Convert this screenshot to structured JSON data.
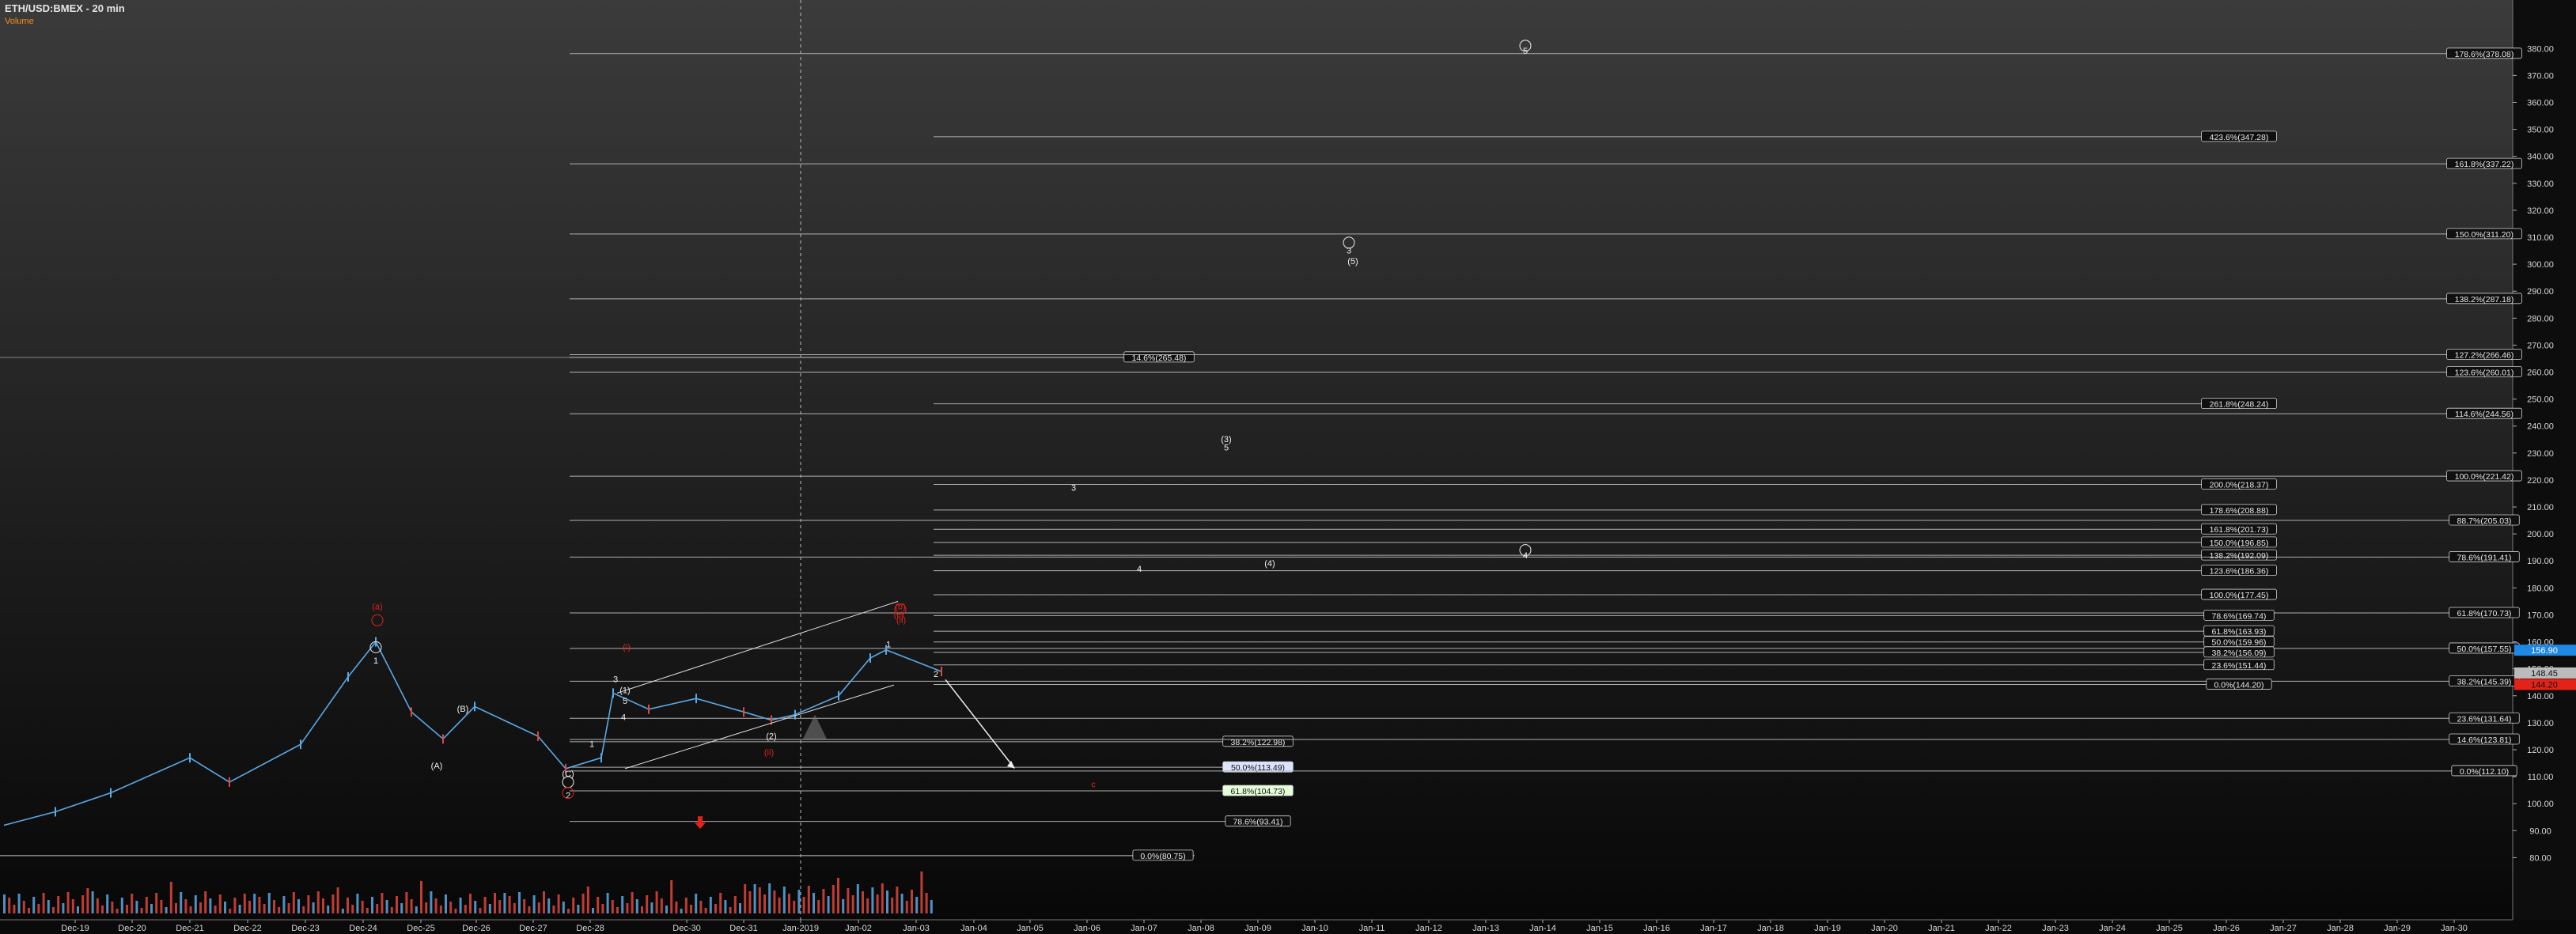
{
  "header": {
    "title": "ETH/USD:BMEX - 20 min",
    "subtitle": "Volume"
  },
  "chart_data": {
    "type": "line",
    "title": "ETH/USD:BMEX - 20 min",
    "ylim": [
      70,
      390
    ],
    "y_ticks": [
      80,
      90,
      100,
      110,
      120,
      130,
      140,
      150,
      160,
      170,
      180,
      190,
      200,
      210,
      220,
      230,
      240,
      250,
      260,
      270,
      280,
      290,
      300,
      310,
      320,
      330,
      340,
      350,
      360,
      370,
      380
    ],
    "y_tick_labels": [
      "80.00",
      "90.00",
      "100.00",
      "110.00",
      "120.00",
      "130.00",
      "140.00",
      "150.00",
      "160.00",
      "170.00",
      "180.00",
      "190.00",
      "200.00",
      "210.00",
      "220.00",
      "230.00",
      "240.00",
      "250.00",
      "260.00",
      "270.00",
      "280.00",
      "290.00",
      "300.00",
      "310.00",
      "320.00",
      "330.00",
      "340.00",
      "350.00",
      "360.00",
      "370.00",
      "380.00"
    ],
    "x_categories": [
      "Dec-19",
      "Dec-20",
      "Dec-21",
      "Dec-22",
      "Dec-23",
      "Dec-24",
      "Dec-25",
      "Dec-26",
      "Dec-27",
      "Dec-28",
      "Dec-30",
      "Dec-31",
      "Jan-2019",
      "Jan-02",
      "Jan-03",
      "Jan-04",
      "Jan-05",
      "Jan-06",
      "Jan-07",
      "Jan-08",
      "Jan-09",
      "Jan-10",
      "Jan-11",
      "Jan-12",
      "Jan-13",
      "Jan-14",
      "Jan-15",
      "Jan-16",
      "Jan-17",
      "Jan-18",
      "Jan-19",
      "Jan-20",
      "Jan-21",
      "Jan-22",
      "Jan-23",
      "Jan-24",
      "Jan-25",
      "Jan-26",
      "Jan-27",
      "Jan-28",
      "Jan-29",
      "Jan-30"
    ],
    "price_series": {
      "name": "ETH/USD:BMEX",
      "x": [
        "Dec-18",
        "Dec-19",
        "Dec-20",
        "Dec-21",
        "Dec-22",
        "Dec-23",
        "Dec-24",
        "Dec-24",
        "Dec-25",
        "Dec-25",
        "Dec-26",
        "Dec-27",
        "Dec-28",
        "Dec-28",
        "Dec-28",
        "Dec-29",
        "Dec-30",
        "Dec-31",
        "Dec-31",
        "Jan-2019",
        "Jan-01",
        "Jan-02",
        "Jan-02",
        "Jan-03"
      ],
      "values": [
        92,
        97,
        104,
        117,
        108,
        122,
        147,
        160,
        134,
        124,
        136,
        125,
        113,
        117,
        141,
        135,
        139,
        134,
        131,
        133,
        140,
        154,
        157,
        149
      ]
    },
    "volume_series": {
      "name": "Volume",
      "type": "bar"
    },
    "last_price": "156.90",
    "price_tags": [
      "148.45",
      "144.20"
    ],
    "fib_levels": [
      {
        "label": "178.6%(378.08)",
        "value": 378.08
      },
      {
        "label": "423.6%(347.28)",
        "value": 347.28
      },
      {
        "label": "161.8%(337.22)",
        "value": 337.22
      },
      {
        "label": "150.0%(311.20)",
        "value": 311.2
      },
      {
        "label": "138.2%(287.18)",
        "value": 287.18
      },
      {
        "label": "14.6%(265.48)",
        "value": 265.48
      },
      {
        "label": "127.2%(266.46)",
        "value": 266.46
      },
      {
        "label": "123.6%(260.01)",
        "value": 260.01
      },
      {
        "label": "261.8%(248.24)",
        "value": 248.24
      },
      {
        "label": "114.6%(244.56)",
        "value": 244.56
      },
      {
        "label": "100.0%(221.42)",
        "value": 221.42
      },
      {
        "label": "200.0%(218.37)",
        "value": 218.37
      },
      {
        "label": "178.6%(208.88)",
        "value": 208.88
      },
      {
        "label": "88.7%(205.03)",
        "value": 205.03
      },
      {
        "label": "161.8%(201.73)",
        "value": 201.73
      },
      {
        "label": "150.0%(196.85)",
        "value": 196.85
      },
      {
        "label": "138.2%(192.09)",
        "value": 192.09
      },
      {
        "label": "78.6%(191.41)",
        "value": 191.41
      },
      {
        "label": "123.6%(186.36)",
        "value": 186.36
      },
      {
        "label": "100.0%(177.45)",
        "value": 177.45
      },
      {
        "label": "61.8%(170.73)",
        "value": 170.73
      },
      {
        "label": "78.6%(169.74)",
        "value": 169.74
      },
      {
        "label": "61.8%(163.93)",
        "value": 163.93
      },
      {
        "label": "50.0%(159.96)",
        "value": 159.96
      },
      {
        "label": "50.0%(157.55)",
        "value": 157.55
      },
      {
        "label": "38.2%(156.09)",
        "value": 156.09
      },
      {
        "label": "23.6%(151.44)",
        "value": 151.44
      },
      {
        "label": "38.2%(145.39)",
        "value": 145.39
      },
      {
        "label": "0.0%(144.20)",
        "value": 144.2
      },
      {
        "label": "23.6%(131.64)",
        "value": 131.64
      },
      {
        "label": "38.2%(122.98)",
        "value": 122.98
      },
      {
        "label": "14.6%(123.81)",
        "value": 123.81
      },
      {
        "label": "50.0%(113.49)",
        "value": 113.49
      },
      {
        "label": "0.0%(112.10)",
        "value": 112.1
      },
      {
        "label": "61.8%(104.73)",
        "value": 104.73
      },
      {
        "label": "78.6%(93.41)",
        "value": 93.41
      },
      {
        "label": "0.0%(80.75)",
        "value": 80.75
      }
    ],
    "wave_labels": [
      "1",
      "(B)",
      "(A)",
      "(C)",
      "2",
      "(1)",
      "5",
      "3",
      "4",
      "1",
      "(2)",
      "1",
      "2",
      "3",
      "4",
      "(4)",
      "(3)",
      "5",
      "3",
      "(5)",
      "4",
      "5",
      "(a)",
      "(b)",
      "(c)",
      "(i)",
      "(ii)",
      "(ii)",
      "c"
    ],
    "colors": {
      "up": "#5aa9e6",
      "down": "#e2453a",
      "label_red": "#e2231a",
      "axis_text": "#d8d8d8"
    }
  }
}
